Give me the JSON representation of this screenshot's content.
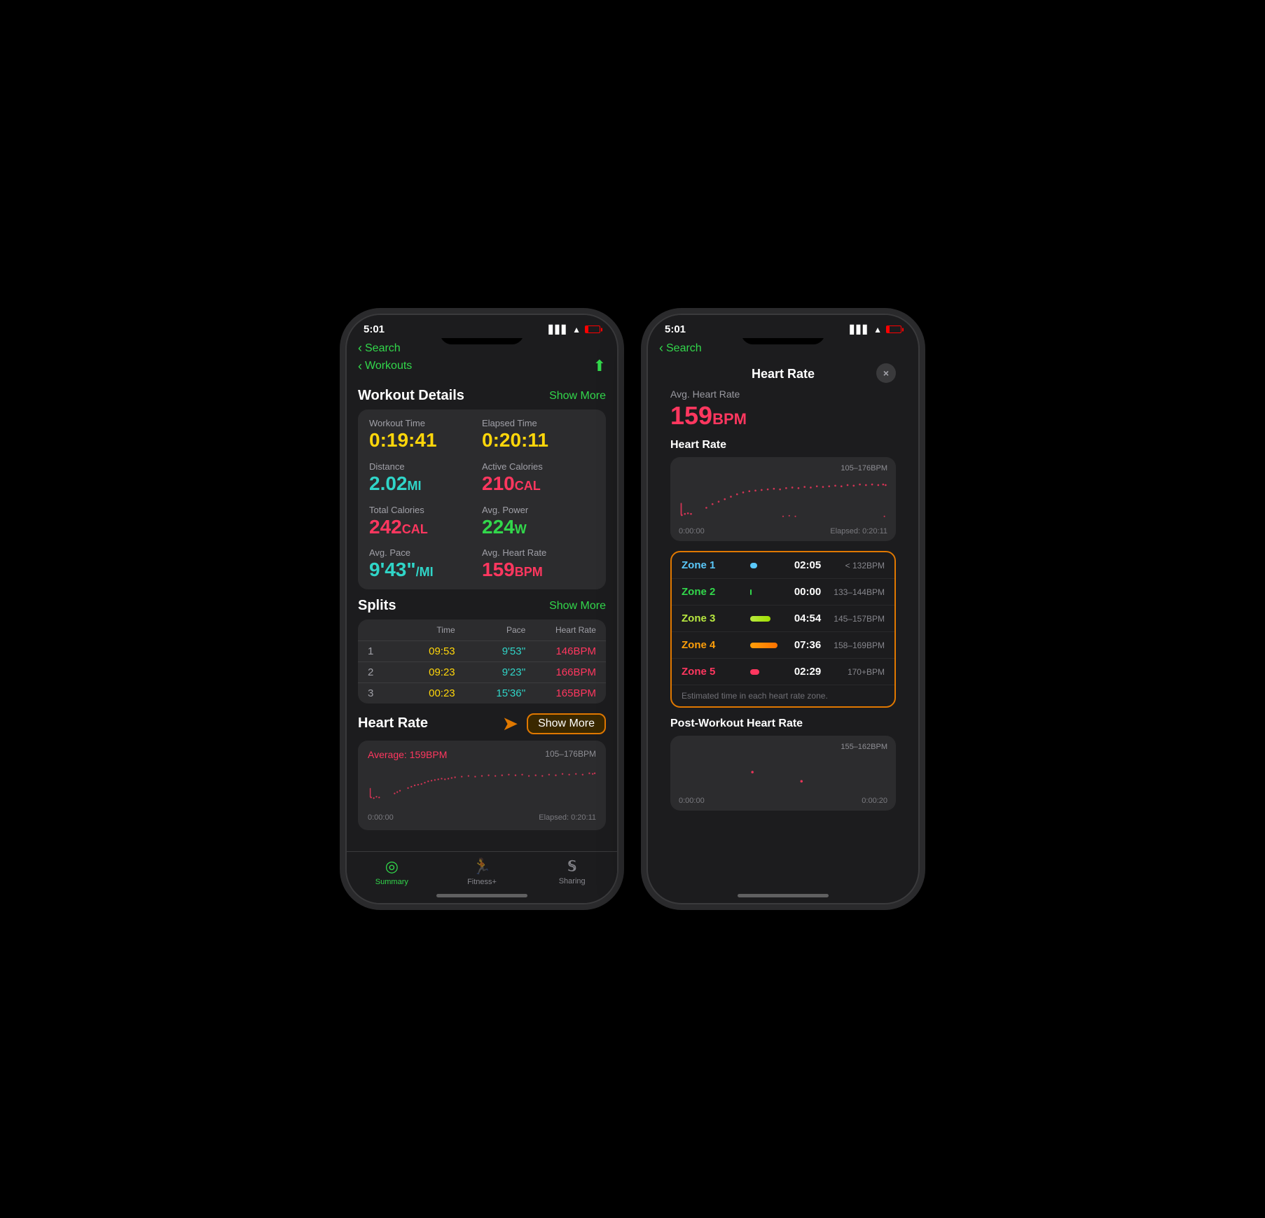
{
  "phone_left": {
    "status": {
      "time": "5:01",
      "back_label": "Search"
    },
    "nav": {
      "back_label": "Workouts",
      "title": "Workout Details",
      "show_more_label": "Show More"
    },
    "workout_stats": [
      {
        "label": "Workout Time",
        "value": "0:19:41",
        "color": "yellow"
      },
      {
        "label": "Elapsed Time",
        "value": "0:20:11",
        "color": "yellow"
      },
      {
        "label": "Distance",
        "value": "2.02",
        "unit": "MI",
        "color": "blue"
      },
      {
        "label": "Active Calories",
        "value": "210",
        "unit": "CAL",
        "color": "pink"
      },
      {
        "label": "Total Calories",
        "value": "242",
        "unit": "CAL",
        "color": "pink"
      },
      {
        "label": "Avg. Power",
        "value": "224",
        "unit": "W",
        "color": "green"
      },
      {
        "label": "Avg. Pace",
        "value": "9'43\"",
        "unit": "/MI",
        "color": "blue"
      },
      {
        "label": "Avg. Heart Rate",
        "value": "159",
        "unit": "BPM",
        "color": "pink"
      }
    ],
    "splits": {
      "title": "Splits",
      "show_more_label": "Show More",
      "columns": [
        "Time",
        "Pace",
        "Heart Rate"
      ],
      "rows": [
        {
          "num": "1",
          "time": "09:53",
          "pace": "9'53''",
          "hr": "146BPM"
        },
        {
          "num": "2",
          "time": "09:23",
          "pace": "9'23''",
          "hr": "166BPM"
        },
        {
          "num": "3",
          "time": "00:23",
          "pace": "15'36''",
          "hr": "165BPM"
        }
      ]
    },
    "heart_rate": {
      "title": "Heart Rate",
      "show_more_label": "Show More",
      "avg_label": "Average: 159BPM",
      "range": "105–176BPM",
      "time_start": "0:00:00",
      "time_end": "Elapsed: 0:20:11"
    },
    "tabs": [
      {
        "id": "summary",
        "label": "Summary",
        "active": true,
        "icon": "⊙"
      },
      {
        "id": "fitness",
        "label": "Fitness+",
        "active": false,
        "icon": "🏃"
      },
      {
        "id": "sharing",
        "label": "Sharing",
        "active": false,
        "icon": "S"
      }
    ]
  },
  "phone_right": {
    "status": {
      "time": "5:01",
      "back_label": "Search"
    },
    "modal": {
      "title": "Heart Rate",
      "close_label": "×"
    },
    "avg_heart_rate": {
      "label": "Avg. Heart Rate",
      "value": "159",
      "unit": "BPM"
    },
    "chart": {
      "section_label": "Heart Rate",
      "range": "105–176BPM",
      "time_start": "0:00:00",
      "time_end": "Elapsed: 0:20:11"
    },
    "zones": [
      {
        "label": "Zone 1",
        "color": "#5ac8fa",
        "bar_color": "#5ac8fa",
        "bar_width": "20%",
        "time": "02:05",
        "bpm": "< 132BPM"
      },
      {
        "label": "Zone 2",
        "color": "#32d74b",
        "bar_color": "#32d74b",
        "bar_width": "5%",
        "time": "00:00",
        "bpm": "133–144BPM"
      },
      {
        "label": "Zone 3",
        "color": "#9fe847",
        "bar_color": "#9fe847",
        "bar_width": "55%",
        "time": "04:54",
        "bpm": "145–157BPM"
      },
      {
        "label": "Zone 4",
        "color": "#ff9f0a",
        "bar_color": "#ff9f0a",
        "bar_width": "75%",
        "time": "07:36",
        "bpm": "158–169BPM"
      },
      {
        "label": "Zone 5",
        "color": "#ff375f",
        "bar_color": "#ff375f",
        "bar_width": "25%",
        "time": "02:29",
        "bpm": "170+BPM"
      }
    ],
    "zones_note": "Estimated time in each heart rate zone.",
    "post_workout": {
      "label": "Post-Workout Heart Rate",
      "range": "155–162BPM",
      "time_start": "0:00:00",
      "time_end": "0:00:20"
    }
  },
  "arrow": {
    "color": "#e07800"
  }
}
